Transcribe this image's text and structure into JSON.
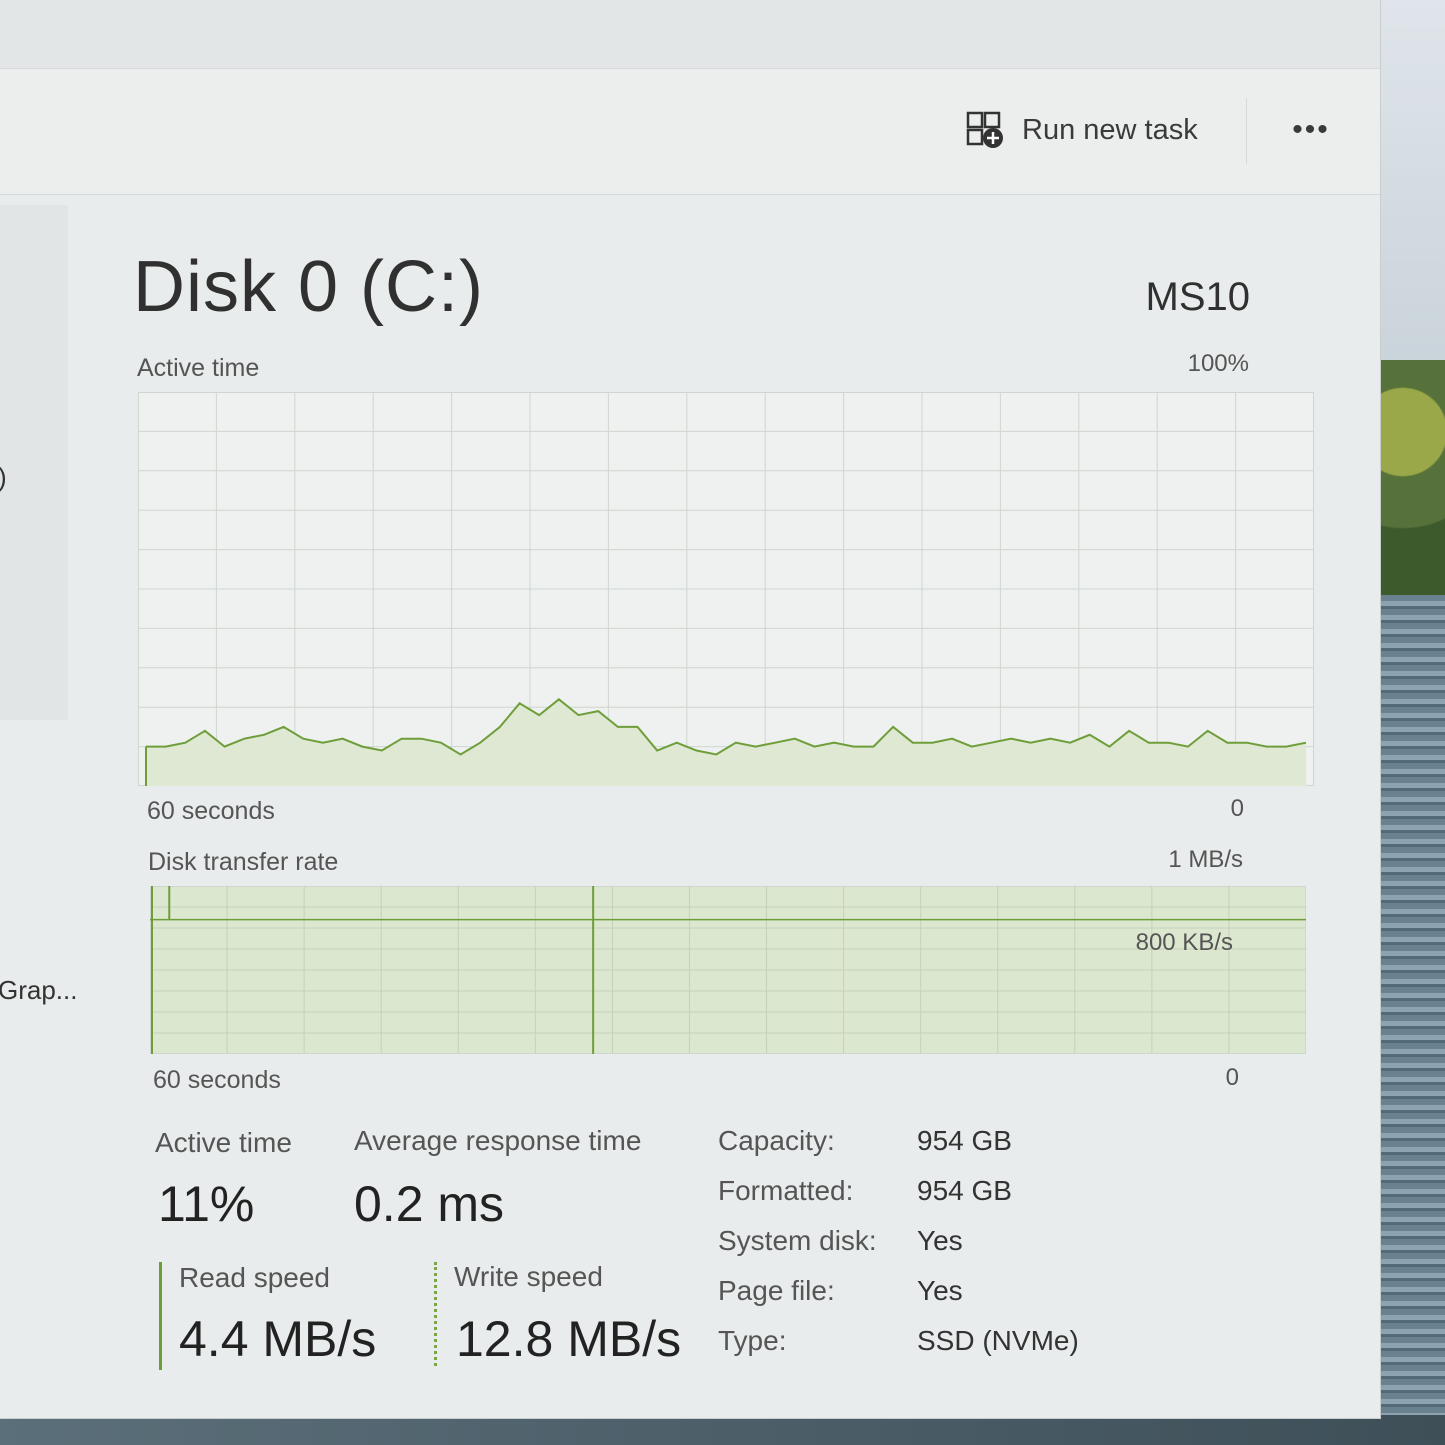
{
  "toolbar": {
    "run_new_task_label": "Run new task",
    "more_label": "•••"
  },
  "nav": {
    "partial_paren": ")",
    "partial_item": "Grap..."
  },
  "header": {
    "title": "Disk 0 (C:)",
    "model": "MS10"
  },
  "active_time_chart": {
    "label": "Active time",
    "max_label": "100%",
    "time_label": "60 seconds",
    "min_label": "0"
  },
  "transfer_chart": {
    "label": "Disk transfer rate",
    "max_label": "1 MB/s",
    "mid_label": "800 KB/s",
    "time_label": "60 seconds",
    "min_label": "0"
  },
  "stats": {
    "active_time_label": "Active time",
    "active_time_value": "11%",
    "avg_response_label": "Average response time",
    "avg_response_value": "0.2 ms",
    "read_speed_label": "Read speed",
    "read_speed_value": "4.4 MB/s",
    "write_speed_label": "Write speed",
    "write_speed_value": "12.8 MB/s"
  },
  "properties": [
    {
      "label": "Capacity:",
      "value": "954 GB"
    },
    {
      "label": "Formatted:",
      "value": "954 GB"
    },
    {
      "label": "System disk:",
      "value": "Yes"
    },
    {
      "label": "Page file:",
      "value": "Yes"
    },
    {
      "label": "Type:",
      "value": "SSD (NVMe)"
    }
  ],
  "colors": {
    "accent_green": "#6e9e3a",
    "chart_fill": "#dfe8d2",
    "grid": "#cfd6cf"
  },
  "chart_data": [
    {
      "type": "area",
      "title": "Active time",
      "ylabel": "",
      "ylim": [
        0,
        100
      ],
      "xlim": [
        60,
        0
      ],
      "x_unit": "seconds",
      "grid": true,
      "values": [
        10,
        10,
        11,
        14,
        10,
        12,
        13,
        15,
        12,
        11,
        12,
        10,
        9,
        12,
        12,
        11,
        8,
        11,
        15,
        21,
        18,
        22,
        18,
        19,
        15,
        15,
        9,
        11,
        9,
        8,
        11,
        10,
        11,
        12,
        10,
        11,
        10,
        10,
        15,
        11,
        11,
        12,
        10,
        11,
        12,
        11,
        12,
        11,
        13,
        10,
        14,
        11,
        11,
        10,
        14,
        11,
        11,
        10,
        10,
        11
      ],
      "series": [
        {
          "name": "Active time",
          "values": [
            10,
            10,
            11,
            14,
            10,
            12,
            13,
            15,
            12,
            11,
            12,
            10,
            9,
            12,
            12,
            11,
            8,
            11,
            15,
            21,
            18,
            22,
            18,
            19,
            15,
            15,
            9,
            11,
            9,
            8,
            11,
            10,
            11,
            12,
            10,
            11,
            10,
            10,
            15,
            11,
            11,
            12,
            10,
            11,
            12,
            11,
            12,
            11,
            13,
            10,
            14,
            11,
            11,
            10,
            14,
            11,
            11,
            10,
            10,
            11
          ]
        }
      ]
    },
    {
      "type": "area",
      "title": "Disk transfer rate",
      "ylabel": "",
      "ylim": [
        0,
        1000
      ],
      "y_unit": "KB/s",
      "xlim": [
        60,
        0
      ],
      "x_unit": "seconds",
      "grid": true,
      "reference_line": 800,
      "note_visible": "fill saturated above scale across the window",
      "spikes_at_seconds": [
        59,
        37
      ]
    }
  ]
}
